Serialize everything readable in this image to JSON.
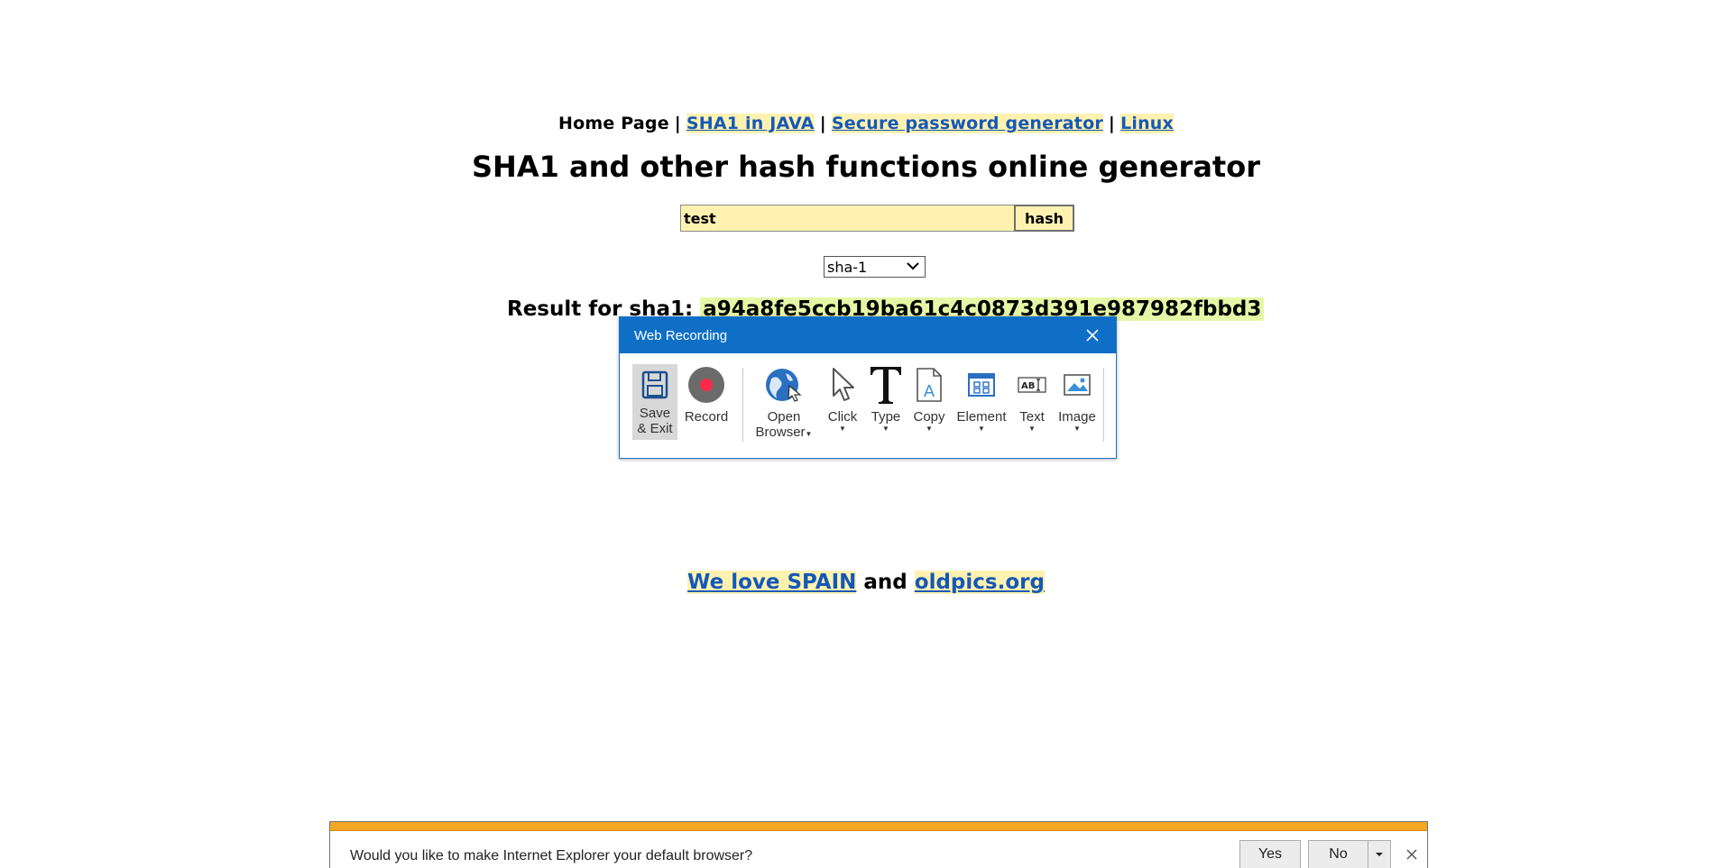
{
  "nav": {
    "home": "Home Page",
    "sep": "|",
    "links": [
      "SHA1 in JAVA",
      "Secure password generator",
      "Linux"
    ]
  },
  "title": "SHA1 and other hash functions online generator",
  "form": {
    "input_value": "test",
    "button_label": "hash",
    "algorithm": "sha-1"
  },
  "result": {
    "label": "Result for sha1:",
    "hash": "a94a8fe5ccb19ba61c4c0873d391e987982fbbd3"
  },
  "footer": {
    "link1": "We love SPAIN",
    "and": "and",
    "link2": "oldpics.org"
  },
  "recording": {
    "title": "Web Recording",
    "tools": [
      {
        "label": "Save & Exit",
        "icon": "save-icon"
      },
      {
        "label": "Record",
        "icon": "record-icon"
      },
      {
        "label": "Open Browser",
        "icon": "open-browser-icon"
      },
      {
        "label": "Click",
        "icon": "cursor-icon"
      },
      {
        "label": "Type",
        "icon": "type-icon"
      },
      {
        "label": "Copy",
        "icon": "copy-icon"
      },
      {
        "label": "Element",
        "icon": "element-icon"
      },
      {
        "label": "Text",
        "icon": "text-icon"
      },
      {
        "label": "Image",
        "icon": "image-icon"
      }
    ],
    "save_line1": "Save",
    "save_line2": "& Exit",
    "open_line1": "Open",
    "open_line2": "Browser"
  },
  "notification": {
    "message": "Would you like to make Internet Explorer your default browser?",
    "yes_label": "Yes",
    "no_label": "No"
  },
  "colors": {
    "link": "#1558b8",
    "highlight": "#fff2b0",
    "hash_bg": "#e5f7a6",
    "titlebar": "#0f6fc6",
    "notif_stripe": "#f5a623"
  }
}
